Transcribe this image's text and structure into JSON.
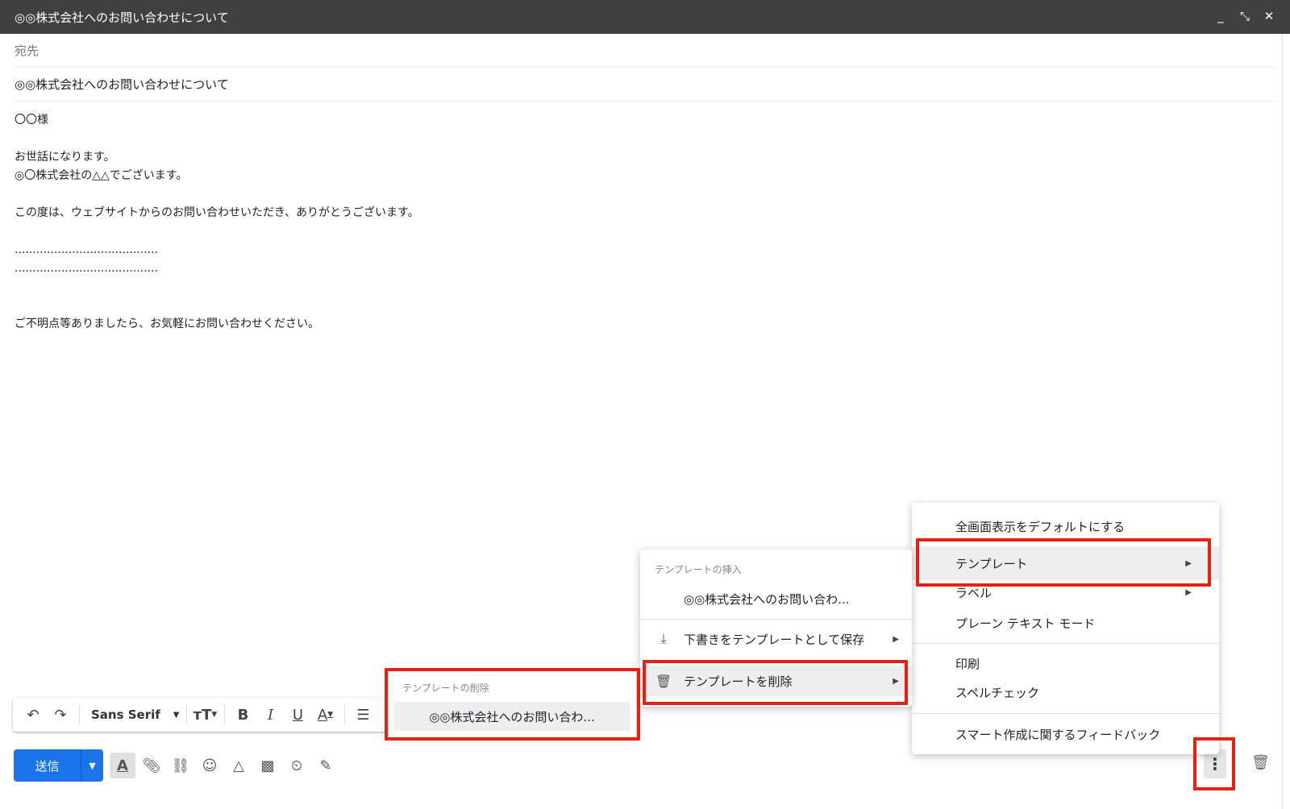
{
  "window": {
    "title": "◎◎株式会社へのお問い合わせについて",
    "controls": [
      "minimize-icon",
      "exit-fullscreen-icon",
      "close-icon"
    ]
  },
  "compose": {
    "to_placeholder": "宛先",
    "subject": "◎◎株式会社へのお問い合わせについて",
    "body_lines": [
      "〇〇様",
      "",
      "お世話になります。",
      "◎〇株式会社の△△でございます。",
      "",
      "この度は、ウェブサイトからのお問い合わせいただき、ありがとうございます。",
      "",
      "........................................",
      "........................................",
      "",
      "",
      "ご不明点等ありましたら、お気軽にお問い合わせください。"
    ]
  },
  "format_toolbar": {
    "font": "Sans Serif"
  },
  "footer": {
    "send_label": "送信"
  },
  "more_menu": {
    "items": [
      {
        "label": "全画面表示をデフォルトにする"
      },
      {
        "label": "テンプレート",
        "submenu": true
      },
      {
        "label": "ラベル",
        "submenu": true
      },
      {
        "label": "プレーン テキスト モード"
      },
      {
        "label": "印刷"
      },
      {
        "label": "スペルチェック"
      },
      {
        "label": "スマート作成に関するフィードバック"
      }
    ]
  },
  "template_menu": {
    "insert_header": "テンプレートの挿入",
    "insert_item": "◎◎株式会社へのお問い合わ...",
    "save_draft": "下書きをテンプレートとして保存",
    "delete": "テンプレートを削除"
  },
  "delete_menu": {
    "header": "テンプレートの削除",
    "item": "◎◎株式会社へのお問い合わ..."
  },
  "colors": {
    "titlebar": "#404040",
    "send_button": "#1a73e8",
    "highlight": "#e8200f"
  }
}
